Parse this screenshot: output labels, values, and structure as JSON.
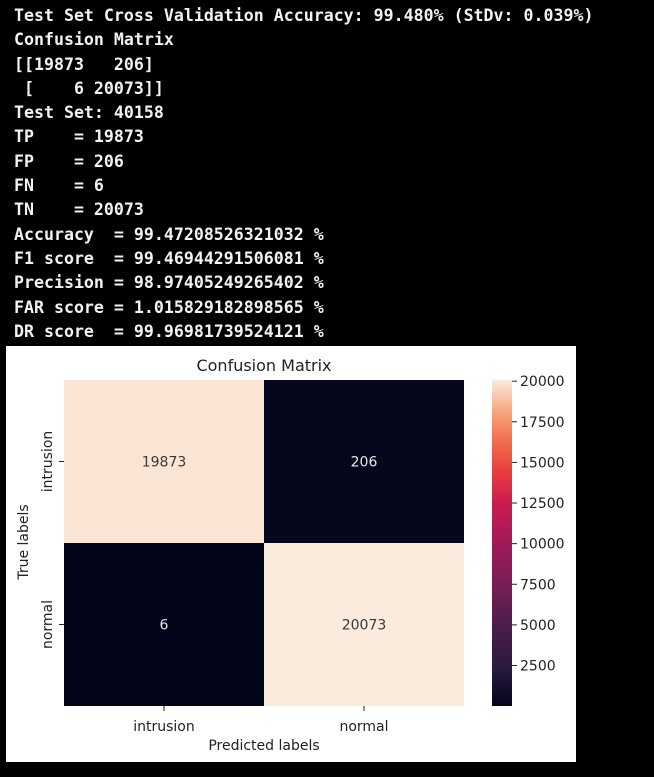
{
  "console": {
    "lines": [
      "Test Set Cross Validation Accuracy: 99.480% (StDv: 0.039%)",
      "Confusion Matrix",
      "[[19873   206]",
      " [    6 20073]]",
      "Test Set: 40158",
      "TP    = 19873",
      "FP    = 206",
      "FN    = 6",
      "TN    = 20073",
      "Accuracy  = 99.47208526321032 %",
      "F1 score  = 99.46944291506081 %",
      "Precision = 98.97405249265402 %",
      "FAR score = 1.015829182898565 %",
      "DR score  = 99.96981739524121 %"
    ]
  },
  "colors": {
    "background": "#000000",
    "console_text": "#f2f2f2",
    "heatmap_low": "#03051a",
    "heatmap_high": "#faebdd"
  },
  "chart_data": {
    "type": "heatmap",
    "title": "Confusion Matrix",
    "xlabel": "Predicted labels",
    "ylabel": "True labels",
    "x_categories": [
      "intrusion",
      "normal"
    ],
    "y_categories": [
      "intrusion",
      "normal"
    ],
    "values": [
      [
        19873,
        206
      ],
      [
        6,
        20073
      ]
    ],
    "colorbar": {
      "ticks": [
        "20000",
        "17500",
        "15000",
        "12500",
        "10000",
        "7500",
        "5000",
        "2500"
      ],
      "tick_values": [
        20000,
        17500,
        15000,
        12500,
        10000,
        7500,
        5000,
        2500
      ],
      "vmin": 6,
      "vmax": 20073,
      "colormap": "rocket"
    }
  }
}
